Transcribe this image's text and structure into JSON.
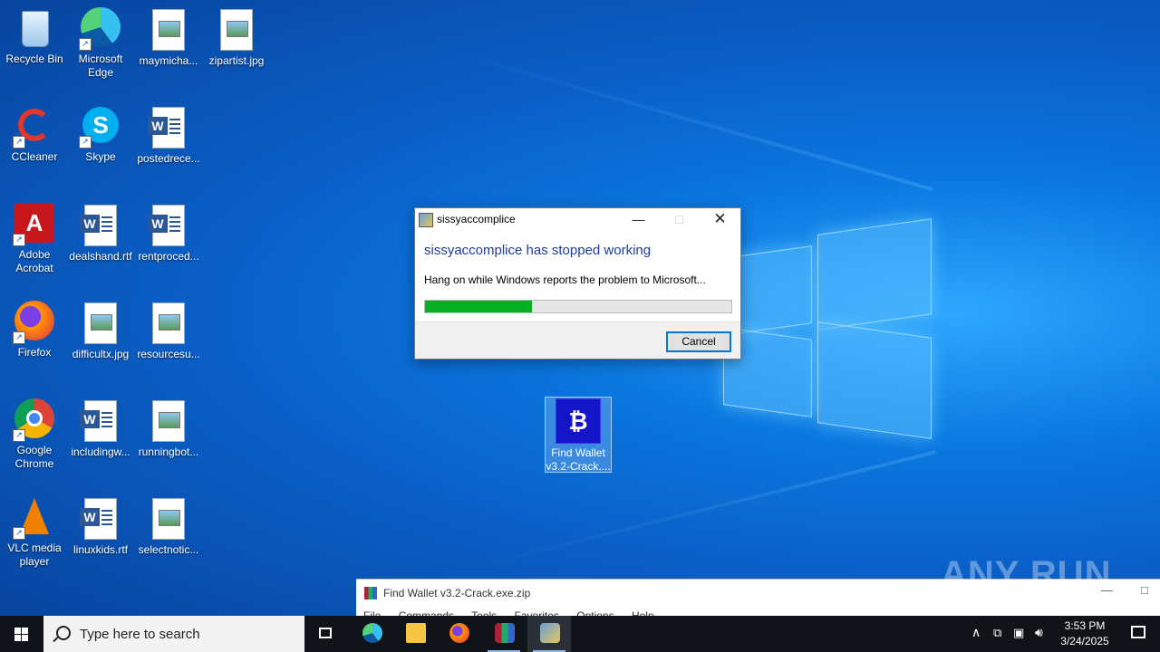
{
  "desktop": {
    "icons": [
      {
        "label": "Recycle Bin"
      },
      {
        "label": "Microsoft Edge"
      },
      {
        "label": "maymicha..."
      },
      {
        "label": "zipartist.jpg"
      },
      {
        "label": "CCleaner"
      },
      {
        "label": "Skype"
      },
      {
        "label": "postedrece..."
      },
      {
        "label": "Adobe Acrobat"
      },
      {
        "label": "dealshand.rtf"
      },
      {
        "label": "rentproced..."
      },
      {
        "label": "Firefox"
      },
      {
        "label": "difficultx.jpg"
      },
      {
        "label": "resourcesu..."
      },
      {
        "label": "Google Chrome"
      },
      {
        "label": "includingw..."
      },
      {
        "label": "runningbot..."
      },
      {
        "label": "VLC media player"
      },
      {
        "label": "linuxkids.rtf"
      },
      {
        "label": "selectnotic..."
      }
    ],
    "selected_icon": {
      "label": "Find Wallet v3.2-Crack...."
    }
  },
  "dialog": {
    "title": "sissyaccomplice",
    "heading": "sissyaccomplice has stopped working",
    "message": "Hang on while Windows reports the problem to Microsoft...",
    "progress": 0.35,
    "cancel_label": "Cancel"
  },
  "winrar": {
    "title": "Find Wallet v3.2-Crack.exe.zip",
    "menu": [
      "File",
      "Commands",
      "Tools",
      "Favorites",
      "Options",
      "Help"
    ]
  },
  "watermark": "ANY RUN",
  "taskbar": {
    "search_placeholder": "Type here to search",
    "time": "3:53 PM",
    "date": "3/24/2025"
  },
  "colors": {
    "accent": "#0078d7",
    "progress_fill": "#06b025",
    "dialog_heading": "#1c3c9c"
  }
}
